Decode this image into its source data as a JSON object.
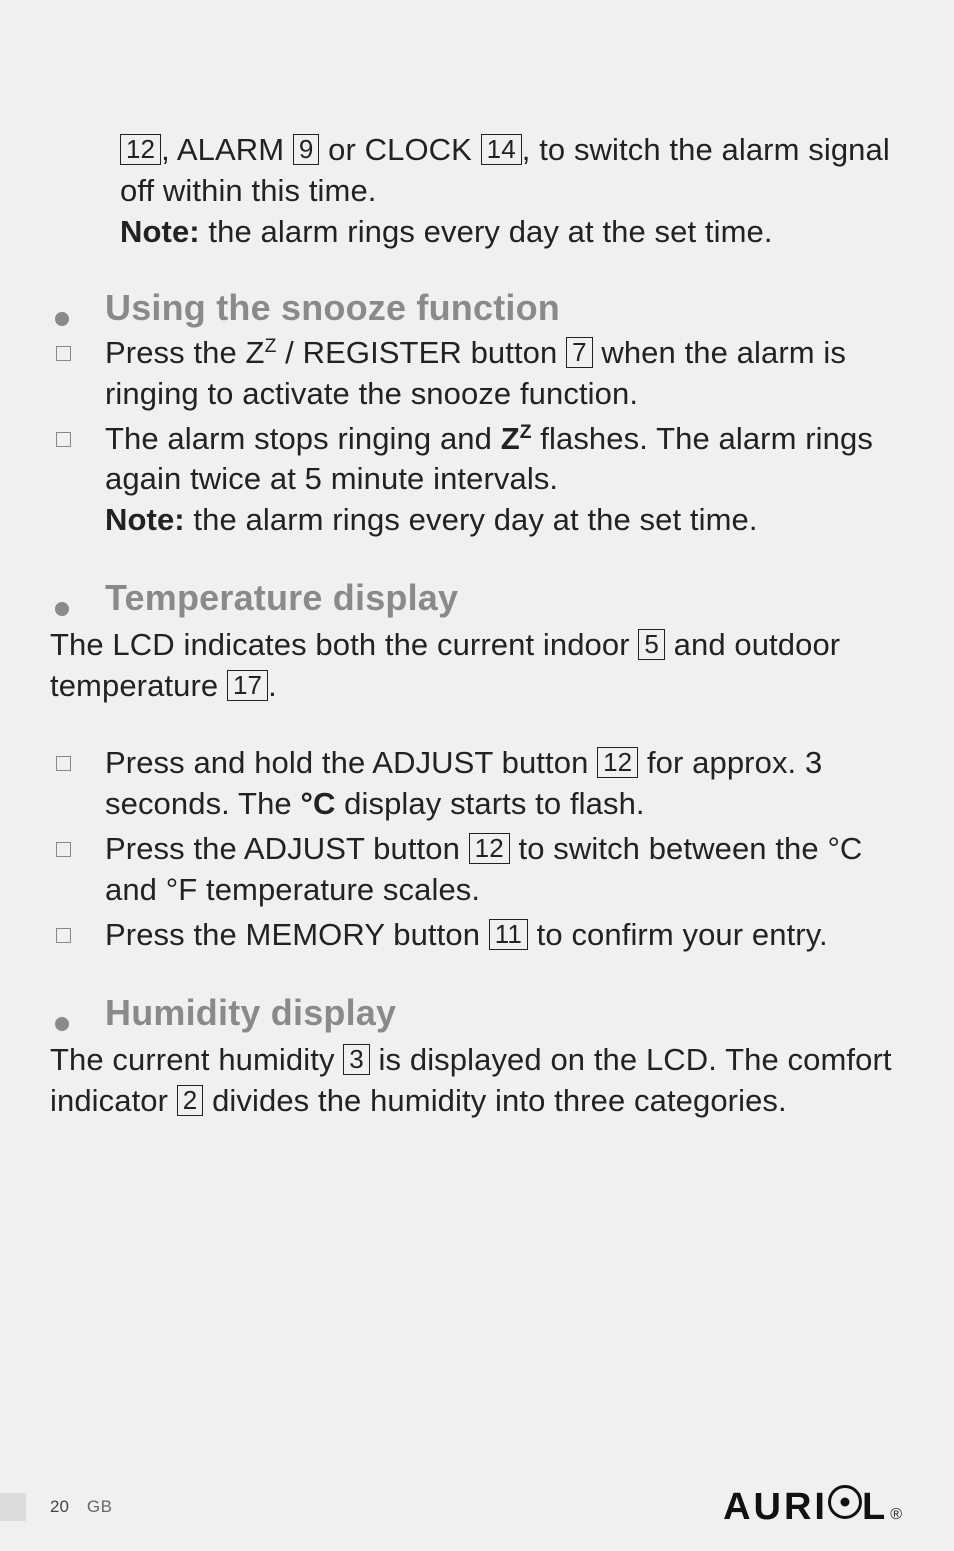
{
  "intro": {
    "line1_pre": ", ALARM ",
    "line1_mid": " or CLOCK ",
    "line1_post": ", to switch the alarm signal off within this time.",
    "box12": "12",
    "box9": "9",
    "box14": "14",
    "note_label": "Note:",
    "note_text": " the alarm rings every day at the set time."
  },
  "snooze": {
    "heading": "Using the snooze function",
    "item1_pre": "Press the Z",
    "item1_sup": "Z",
    "item1_mid": " / REGISTER button ",
    "box7": "7",
    "item1_post": " when the alarm is ringing to activate the snooze function.",
    "item2_pre": "The alarm stops ringing and ",
    "item2_bold": "Z",
    "item2_sup": "Z",
    "item2_post": " flashes. The alarm rings again twice at 5 minute intervals.",
    "note_label": "Note:",
    "note_text": " the alarm rings every day at the set time."
  },
  "temperature": {
    "heading": "Temperature display",
    "intro_pre": "The LCD indicates both the current indoor ",
    "box5": "5",
    "intro_mid": " and outdoor temperature ",
    "box17": "17",
    "intro_post": ".",
    "item1_pre": "Press and hold the ADJUST button ",
    "box12": "12",
    "item1_post": " for approx. 3 seconds. The ",
    "degC": "°C",
    "item1_end": " display starts to flash.",
    "item2_pre": "Press the ADJUST button ",
    "item2_post": " to switch between the °C and  °F temperature scales.",
    "item3_pre": "Press the MEMORY button ",
    "box11": "11",
    "item3_post": " to confirm your entry."
  },
  "humidity": {
    "heading": "Humidity display",
    "line_pre": "The current humidity ",
    "box3": "3",
    "line_mid": " is displayed on the LCD. The comfort indicator ",
    "box2": "2",
    "line_post": " divides the humidity into three categories."
  },
  "footer": {
    "page": "20",
    "region": "GB",
    "brand_pre": "AURI",
    "brand_post": "L",
    "brand_reg": "®"
  }
}
